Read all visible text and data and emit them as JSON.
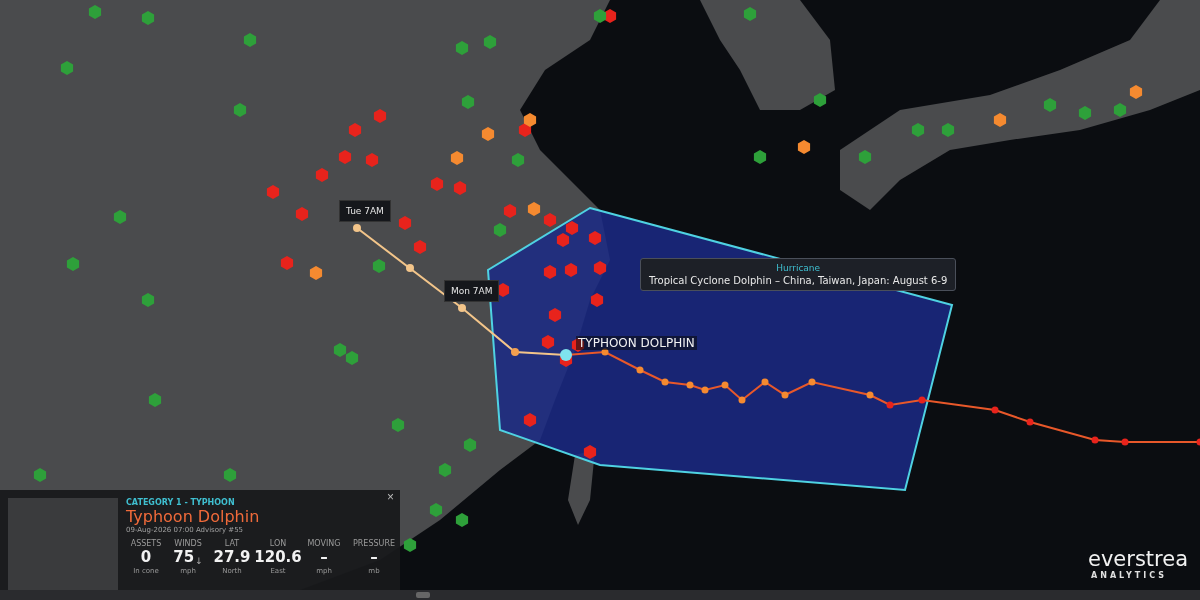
{
  "map": {
    "time_labels": [
      {
        "label": "Tue 7AM"
      },
      {
        "label": "Mon 7AM"
      }
    ],
    "storm_label": "TYPHOON DOLPHIN",
    "tooltip": {
      "category": "Hurricane",
      "title": "Tropical Cyclone Dolphin – China, Taiwan, Japan: August 6-9"
    },
    "asset_markers": [
      {
        "color": "#e8231c"
      },
      {
        "color": "#e8231c"
      },
      {
        "color": "#e8231c"
      },
      {
        "color": "#e8231c"
      },
      {
        "color": "#e8231c"
      },
      {
        "color": "#e8231c"
      },
      {
        "color": "#e8231c"
      },
      {
        "color": "#e8231c"
      },
      {
        "color": "#e8231c"
      },
      {
        "color": "#e8231c"
      },
      {
        "color": "#e8231c"
      },
      {
        "color": "#e8231c"
      },
      {
        "color": "#e8231c"
      },
      {
        "color": "#e8231c"
      },
      {
        "color": "#e8231c"
      },
      {
        "color": "#e8231c"
      },
      {
        "color": "#e8231c"
      },
      {
        "color": "#e8231c"
      },
      {
        "color": "#e8231c"
      },
      {
        "color": "#e8231c"
      },
      {
        "color": "#e8231c"
      },
      {
        "color": "#e8231c"
      },
      {
        "color": "#e8231c"
      },
      {
        "color": "#e8231c"
      },
      {
        "color": "#e8231c"
      },
      {
        "color": "#e8231c"
      },
      {
        "color": "#e8231c"
      },
      {
        "color": "#e8231c"
      },
      {
        "color": "#e8231c"
      },
      {
        "color": "#e8231c"
      },
      {
        "color": "#f58a30"
      },
      {
        "color": "#f58a30"
      },
      {
        "color": "#f58a30"
      },
      {
        "color": "#f58a30"
      },
      {
        "color": "#f58a30"
      },
      {
        "color": "#f58a30"
      },
      {
        "color": "#f58a30"
      },
      {
        "color": "#f58a30"
      },
      {
        "color": "#2ea03a"
      },
      {
        "color": "#2ea03a"
      },
      {
        "color": "#2ea03a"
      },
      {
        "color": "#2ea03a"
      },
      {
        "color": "#2ea03a"
      },
      {
        "color": "#2ea03a"
      },
      {
        "color": "#2ea03a"
      },
      {
        "color": "#2ea03a"
      },
      {
        "color": "#2ea03a"
      },
      {
        "color": "#2ea03a"
      },
      {
        "color": "#2ea03a"
      },
      {
        "color": "#2ea03a"
      },
      {
        "color": "#2ea03a"
      },
      {
        "color": "#2ea03a"
      },
      {
        "color": "#2ea03a"
      },
      {
        "color": "#2ea03a"
      },
      {
        "color": "#2ea03a"
      },
      {
        "color": "#2ea03a"
      },
      {
        "color": "#2ea03a"
      },
      {
        "color": "#2ea03a"
      },
      {
        "color": "#2ea03a"
      },
      {
        "color": "#2ea03a"
      },
      {
        "color": "#2ea03a"
      },
      {
        "color": "#2ea03a"
      },
      {
        "color": "#2ea03a"
      },
      {
        "color": "#2ea03a"
      },
      {
        "color": "#2ea03a"
      },
      {
        "color": "#2ea03a"
      },
      {
        "color": "#2ea03a"
      },
      {
        "color": "#2ea03a"
      },
      {
        "color": "#2ea03a"
      },
      {
        "color": "#2ea03a"
      },
      {
        "color": "#2ea03a"
      },
      {
        "color": "#2ea03a"
      },
      {
        "color": "#2ea03a"
      }
    ]
  },
  "storm_panel": {
    "category": "CATEGORY 1 - TYPHOON",
    "title": "Typhoon Dolphin",
    "advisory": "09-Aug-2026 07:00 Advisory #55",
    "close": "×",
    "stats": [
      {
        "label": "ASSETS",
        "value": "0",
        "unit": "In cone"
      },
      {
        "label": "WINDS",
        "value": "75",
        "trend": "↓",
        "unit": "mph"
      },
      {
        "label": "LAT",
        "value": "27.9",
        "unit": "North"
      },
      {
        "label": "LON",
        "value": "120.6",
        "unit": "East"
      },
      {
        "label": "MOVING",
        "value": "–",
        "unit": "mph"
      },
      {
        "label": "PRESSURE",
        "value": "–",
        "unit": "mb"
      }
    ]
  },
  "logo": {
    "name": "everstrea",
    "tagline": "ANALYTICS"
  }
}
